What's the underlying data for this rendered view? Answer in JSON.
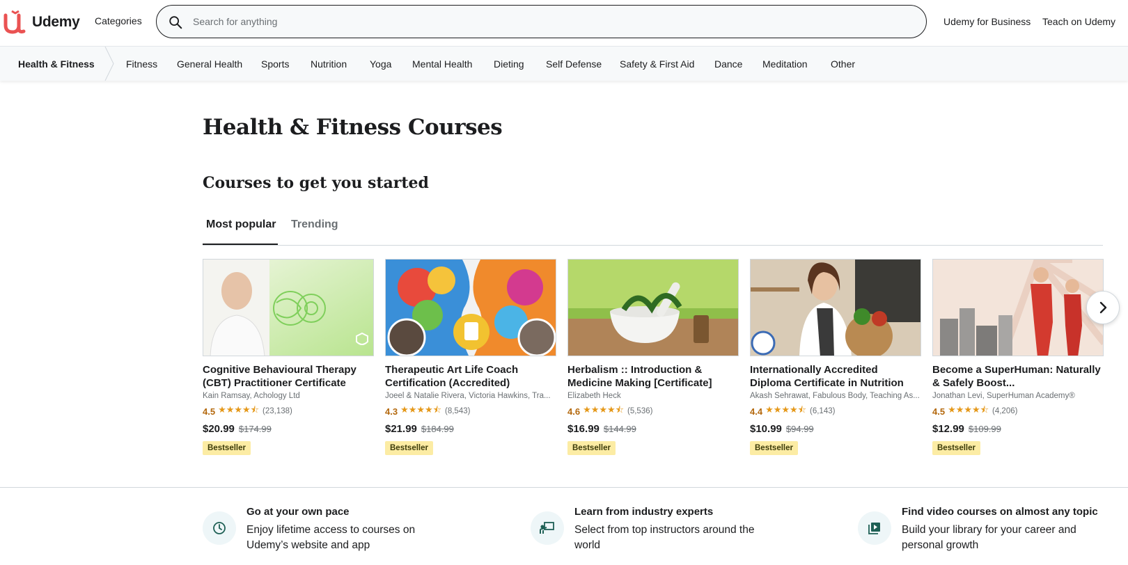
{
  "header": {
    "logo_text": "Udemy",
    "categories_label": "Categories",
    "search_placeholder": "Search for anything",
    "business_link": "Udemy for Business",
    "teach_link": "Teach on Udemy"
  },
  "subnav": {
    "root": "Health & Fitness",
    "items": [
      "Fitness",
      "General Health",
      "Sports",
      "Nutrition",
      "Yoga",
      "Mental Health",
      "Dieting",
      "Self Defense",
      "Safety & First Aid",
      "Dance",
      "Meditation",
      "Other"
    ]
  },
  "main": {
    "page_title": "Health & Fitness Courses",
    "section_title": "Courses to get you started",
    "tabs": [
      {
        "label": "Most popular",
        "active": true
      },
      {
        "label": "Trending",
        "active": false
      }
    ]
  },
  "courses": [
    {
      "title": "Cognitive Behavioural Therapy (CBT) Practitioner Certificate",
      "authors": "Kain Ramsay, Achology Ltd",
      "rating": "4.5",
      "stars": "★★★★⯪",
      "reviews": "(23,138)",
      "price": "$20.99",
      "old_price": "$174.99",
      "badge": "Bestseller"
    },
    {
      "title": "Therapeutic Art Life Coach Certification (Accredited)",
      "authors": "Joeel & Natalie Rivera, Victoria Hawkins, Tra...",
      "rating": "4.3",
      "stars": "★★★★⯪",
      "reviews": "(8,543)",
      "price": "$21.99",
      "old_price": "$184.99",
      "badge": "Bestseller"
    },
    {
      "title": "Herbalism :: Introduction & Medicine Making [Certificate]",
      "authors": "Elizabeth Heck",
      "rating": "4.6",
      "stars": "★★★★⯪",
      "reviews": "(5,536)",
      "price": "$16.99",
      "old_price": "$144.99",
      "badge": "Bestseller"
    },
    {
      "title": "Internationally Accredited Diploma Certificate in Nutrition",
      "authors": "Akash Sehrawat, Fabulous Body, Teaching As...",
      "rating": "4.4",
      "stars": "★★★★⯪",
      "reviews": "(6,143)",
      "price": "$10.99",
      "old_price": "$94.99",
      "badge": "Bestseller"
    },
    {
      "title": "Become a SuperHuman: Naturally & Safely Boost...",
      "authors": "Jonathan Levi, SuperHuman Academy®",
      "rating": "4.5",
      "stars": "★★★★⯪",
      "reviews": "(4,206)",
      "price": "$12.99",
      "old_price": "$109.99",
      "badge": "Bestseller"
    }
  ],
  "benefits": [
    {
      "icon": "clock-icon",
      "title": "Go at your own pace",
      "text": "Enjoy lifetime access to courses on Udemy’s website and app"
    },
    {
      "icon": "instructor-icon",
      "title": "Learn from industry experts",
      "text": "Select from top instructors around the world"
    },
    {
      "icon": "video-library-icon",
      "title": "Find video courses on almost any topic",
      "text": "Build your library for your career and personal growth"
    }
  ],
  "colors": {
    "brand": "#a435f0",
    "logo_red": "#ea5252",
    "rating": "#b4690e",
    "star": "#e59819",
    "badge_bg": "#fceca4"
  }
}
